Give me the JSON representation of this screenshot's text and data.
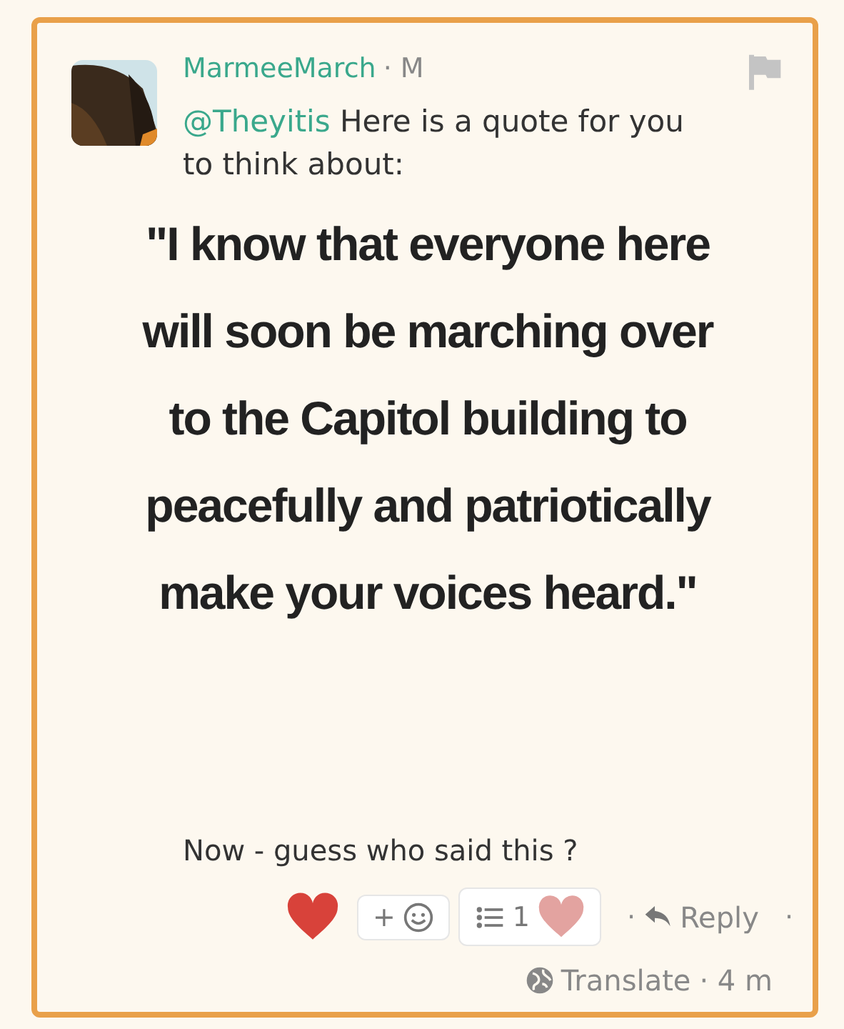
{
  "post": {
    "author": "MarmeeMarch",
    "badge": "· M",
    "flagged": false,
    "mention": "@Theyitis",
    "intro": "Here is a quote for you to think about:",
    "quote": "\"I know that everyone here will soon be marching over to the Capitol building to peacefully and patriotically make your voices heard.\"",
    "closing": "Now - guess who said this ?",
    "liked": true,
    "add_reaction": "+",
    "reaction_count": "1",
    "reply_prefix": "·",
    "reply": "Reply",
    "reply_suffix": "·",
    "translate": "Translate",
    "time": "· 4 m"
  }
}
